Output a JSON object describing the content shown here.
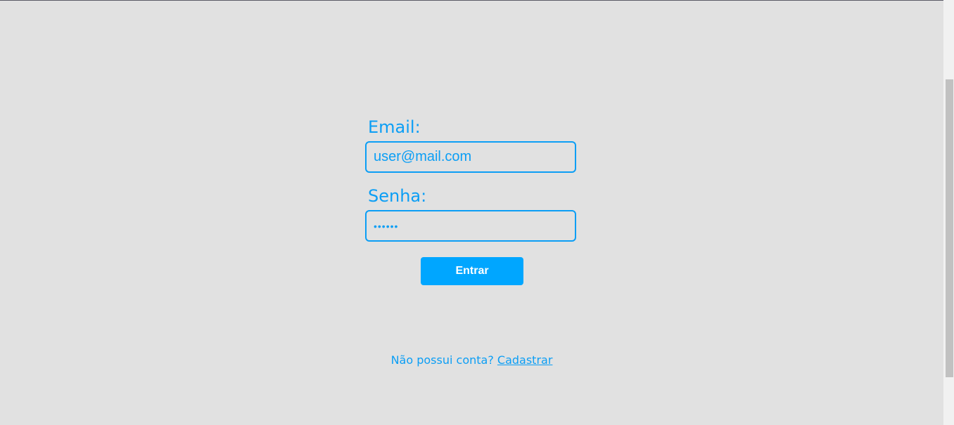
{
  "login": {
    "email_label": "Email:",
    "email_value": "user@mail.com",
    "password_label": "Senha:",
    "password_value": "123456",
    "submit_label": "Entrar"
  },
  "signup": {
    "prompt": "Não possui conta?",
    "link_label": "Cadastrar"
  },
  "colors": {
    "accent": "#0b9ef5",
    "button": "#00a6ff",
    "background": "#e1e1e1"
  }
}
